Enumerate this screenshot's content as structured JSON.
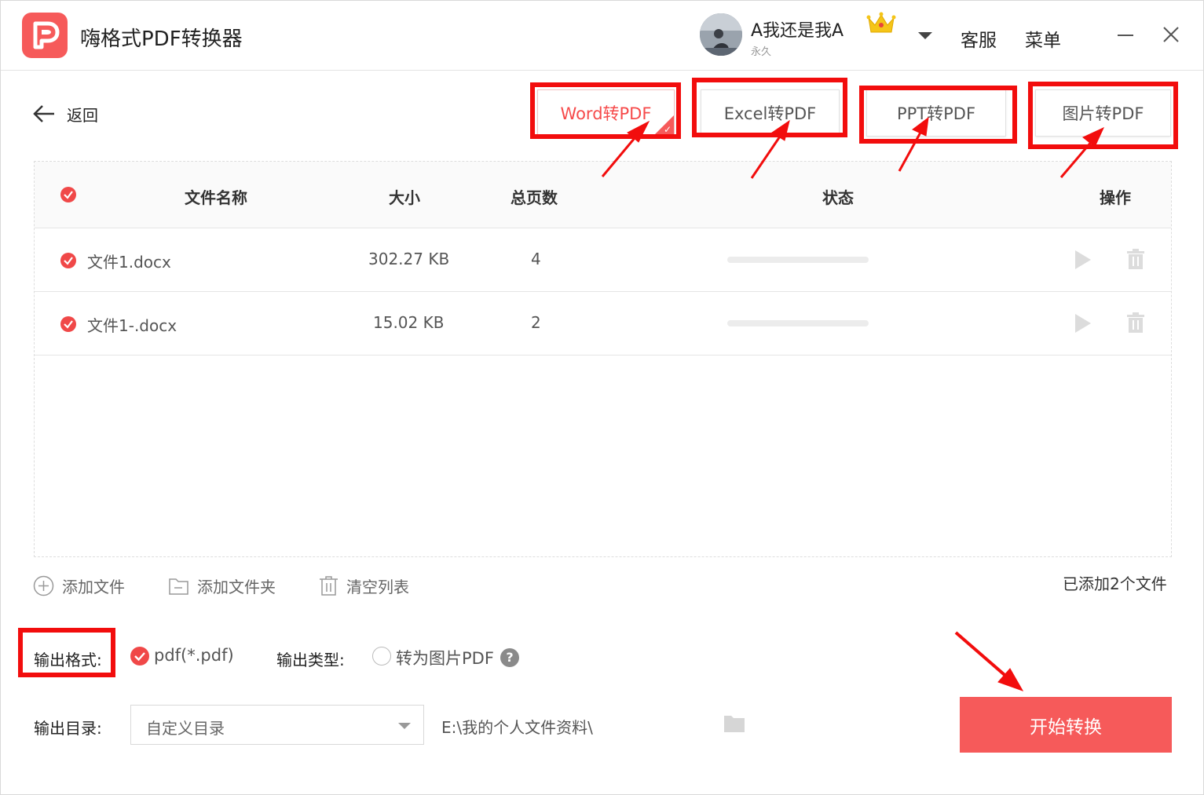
{
  "app": {
    "title": "嗨格式PDF转换器",
    "user_name": "A我还是我A",
    "member_tier": "永久",
    "service_label": "客服",
    "menu_label": "菜单"
  },
  "nav": {
    "back_label": "返回"
  },
  "tabs": [
    {
      "label": "Word转PDF",
      "active": true
    },
    {
      "label": "Excel转PDF",
      "active": false
    },
    {
      "label": "PPT转PDF",
      "active": false
    },
    {
      "label": "图片转PDF",
      "active": false
    }
  ],
  "table": {
    "headers": {
      "name": "文件名称",
      "size": "大小",
      "pages": "总页数",
      "status": "状态",
      "actions": "操作"
    },
    "rows": [
      {
        "name": "文件1.docx",
        "size": "302.27 KB",
        "pages": "4",
        "progress": 0
      },
      {
        "name": "文件1-.docx",
        "size": "15.02 KB",
        "pages": "2",
        "progress": 0
      }
    ]
  },
  "actions": {
    "add_file": "添加文件",
    "add_folder": "添加文件夹",
    "clear_list": "清空列表",
    "file_count": "已添加2个文件"
  },
  "output": {
    "format_label": "输出格式:",
    "format_option": "pdf(*.pdf)",
    "type_label": "输出类型:",
    "type_option": "转为图片PDF",
    "type_help": "?",
    "dir_label": "输出目录:",
    "dir_select_value": "自定义目录",
    "dir_path": "E:\\我的个人文件资料\\"
  },
  "start_button": "开始转换",
  "colors": {
    "accent": "#f65a5a",
    "annotation": "#f20d0d",
    "checkbox": "#f04848"
  }
}
